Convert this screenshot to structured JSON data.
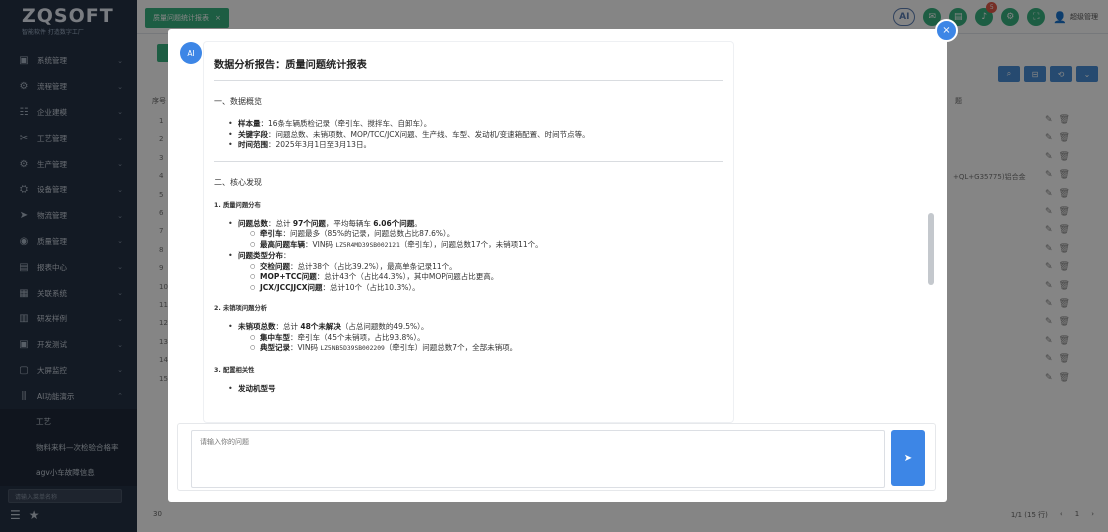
{
  "app": {
    "brand": "ZQSOFT",
    "brand_sub": "智能软件 打造数字工厂",
    "tab_label": "质量问题统计报表",
    "ai_label": "AI",
    "notification_count": "5",
    "user_name": "超级管理",
    "colors": {
      "sidebar_bg": "#263245",
      "accent_green": "#39b380",
      "accent_blue": "#3d86e6"
    }
  },
  "sidebar": {
    "items": [
      {
        "label": "系统管理",
        "icon": "system-icon"
      },
      {
        "label": "流程管理",
        "icon": "flow-icon"
      },
      {
        "label": "企业建模",
        "icon": "model-icon"
      },
      {
        "label": "工艺管理",
        "icon": "tools-icon"
      },
      {
        "label": "生产管理",
        "icon": "production-icon"
      },
      {
        "label": "设备管理",
        "icon": "equipment-icon"
      },
      {
        "label": "物流管理",
        "icon": "logistics-icon"
      },
      {
        "label": "质量管理",
        "icon": "quality-icon"
      },
      {
        "label": "报表中心",
        "icon": "report-icon"
      },
      {
        "label": "关联系统",
        "icon": "link-icon"
      },
      {
        "label": "研发样例",
        "icon": "sample-icon"
      },
      {
        "label": "开发测试",
        "icon": "dev-icon"
      },
      {
        "label": "大屏监控",
        "icon": "screen-icon"
      },
      {
        "label": "AI功能演示",
        "icon": "ai-icon"
      }
    ],
    "subitems": [
      "工艺",
      "物料来料—次检验合格率",
      "agv小车故障信息"
    ],
    "search_placeholder": "请输入菜单名称"
  },
  "background_table": {
    "header_no": "序号",
    "header_right": "题",
    "rows": [
      "1",
      "2",
      "3",
      "4",
      "5",
      "6",
      "7",
      "8",
      "9",
      "10",
      "11",
      "12",
      "13",
      "14",
      "15"
    ],
    "row4_extra": "+QL+G35775)铝合金",
    "page_size": "30",
    "pagination": "1/1 (15 行)"
  },
  "dialog": {
    "avatar_label": "AI",
    "title": "数据分析报告：质量问题统计报表",
    "overview": {
      "heading": "一、数据概览",
      "items": [
        {
          "key": "样本量",
          "text": "：16条车辆质检记录（牵引车、搅拌车、自卸车）。"
        },
        {
          "key": "关键字段",
          "text": "：问题总数、未销项数、MOP/TCC/JCX问题、生产线、车型、发动机/变速箱配置、时间节点等。"
        },
        {
          "key": "时间范围",
          "text": "：2025年3月1日至3月13日。"
        }
      ]
    },
    "findings": {
      "heading": "二、核心发现",
      "sec1": {
        "heading": "1. 质量问题分布",
        "total_key": "问题总数",
        "total_a": "：总计 ",
        "total_b": "97个问题",
        "total_c": "，平均每辆车 ",
        "total_d": "6.06个问题",
        "total_e": "。",
        "tractor_key": "牵引车",
        "tractor_text": "：问题最多（85%的记录，问题总数占比87.6%）。",
        "top_key": "最高问题车辆",
        "top_a": "：VIN码 ",
        "top_vin": "LZ5R4MD39SB002121",
        "top_b": "（牵引车），问题总数17个，未销项11个。",
        "types_key": "问题类型分布",
        "types_colon": "：",
        "type1_key": "交检问题",
        "type1_text": "：总计38个（占比39.2%），最高单条记录11个。",
        "type2_key": "MOP+TCC问题",
        "type2_text": "：总计43个（占比44.3%），其中MOP问题占比更高。",
        "type3_key": "JCX/JCCJJCX问题",
        "type3_text": "：总计10个（占比10.3%）。"
      },
      "sec2": {
        "heading": "2. 未销项问题分析",
        "total_key": "未销项总数",
        "total_a": "：总计 ",
        "total_b": "48个未解决",
        "total_c": "（占总问题数的49.5%）。",
        "focus_key": "集中车型",
        "focus_text": "：牵引车（45个未销项，占比93.8%）。",
        "typical_key": "典型记录",
        "typical_a": "：VIN码 ",
        "typical_vin": "LZ5NB5D39SB002209",
        "typical_b": "（牵引车）问题总数7个，全部未销项。"
      },
      "sec3": {
        "heading": "3. 配置相关性",
        "partial": "发动机型号"
      }
    },
    "input_placeholder": "请输入你的问题"
  }
}
